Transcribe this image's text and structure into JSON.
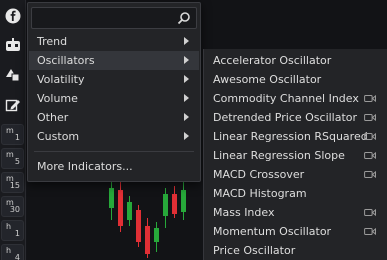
{
  "toolbar": {
    "icons": [
      "facebook-icon",
      "robot-icon",
      "shapes-icon",
      "pencil-settings-icon"
    ],
    "timeframes": [
      {
        "unit": "m",
        "value": "1"
      },
      {
        "unit": "m",
        "value": "5"
      },
      {
        "unit": "m",
        "value": "15"
      },
      {
        "unit": "m",
        "value": "30"
      },
      {
        "unit": "h",
        "value": "1"
      },
      {
        "unit": "h",
        "value": "4"
      }
    ]
  },
  "menu": {
    "search": {
      "value": "",
      "placeholder": ""
    },
    "items": [
      {
        "label": "Trend"
      },
      {
        "label": "Oscillators"
      },
      {
        "label": "Volatility"
      },
      {
        "label": "Volume"
      },
      {
        "label": "Other"
      },
      {
        "label": "Custom"
      }
    ],
    "more_label": "More Indicators..."
  },
  "submenu": {
    "items": [
      {
        "label": "Accelerator Oscillator",
        "video": false
      },
      {
        "label": "Awesome Oscillator",
        "video": false
      },
      {
        "label": "Commodity Channel Index",
        "video": true
      },
      {
        "label": "Detrended Price Oscillator",
        "video": true
      },
      {
        "label": "Linear Regression RSquared",
        "video": true
      },
      {
        "label": "Linear Regression Slope",
        "video": true
      },
      {
        "label": "MACD Crossover",
        "video": true
      },
      {
        "label": "MACD Histogram",
        "video": false
      },
      {
        "label": "Mass Index",
        "video": true
      },
      {
        "label": "Momentum Oscillator",
        "video": true
      },
      {
        "label": "Price Oscillator",
        "video": false
      }
    ]
  },
  "colors": {
    "menu_bg": "#232427",
    "active_bg": "#34363b",
    "candle_up": "#27a83a",
    "candle_down": "#e02f35"
  }
}
